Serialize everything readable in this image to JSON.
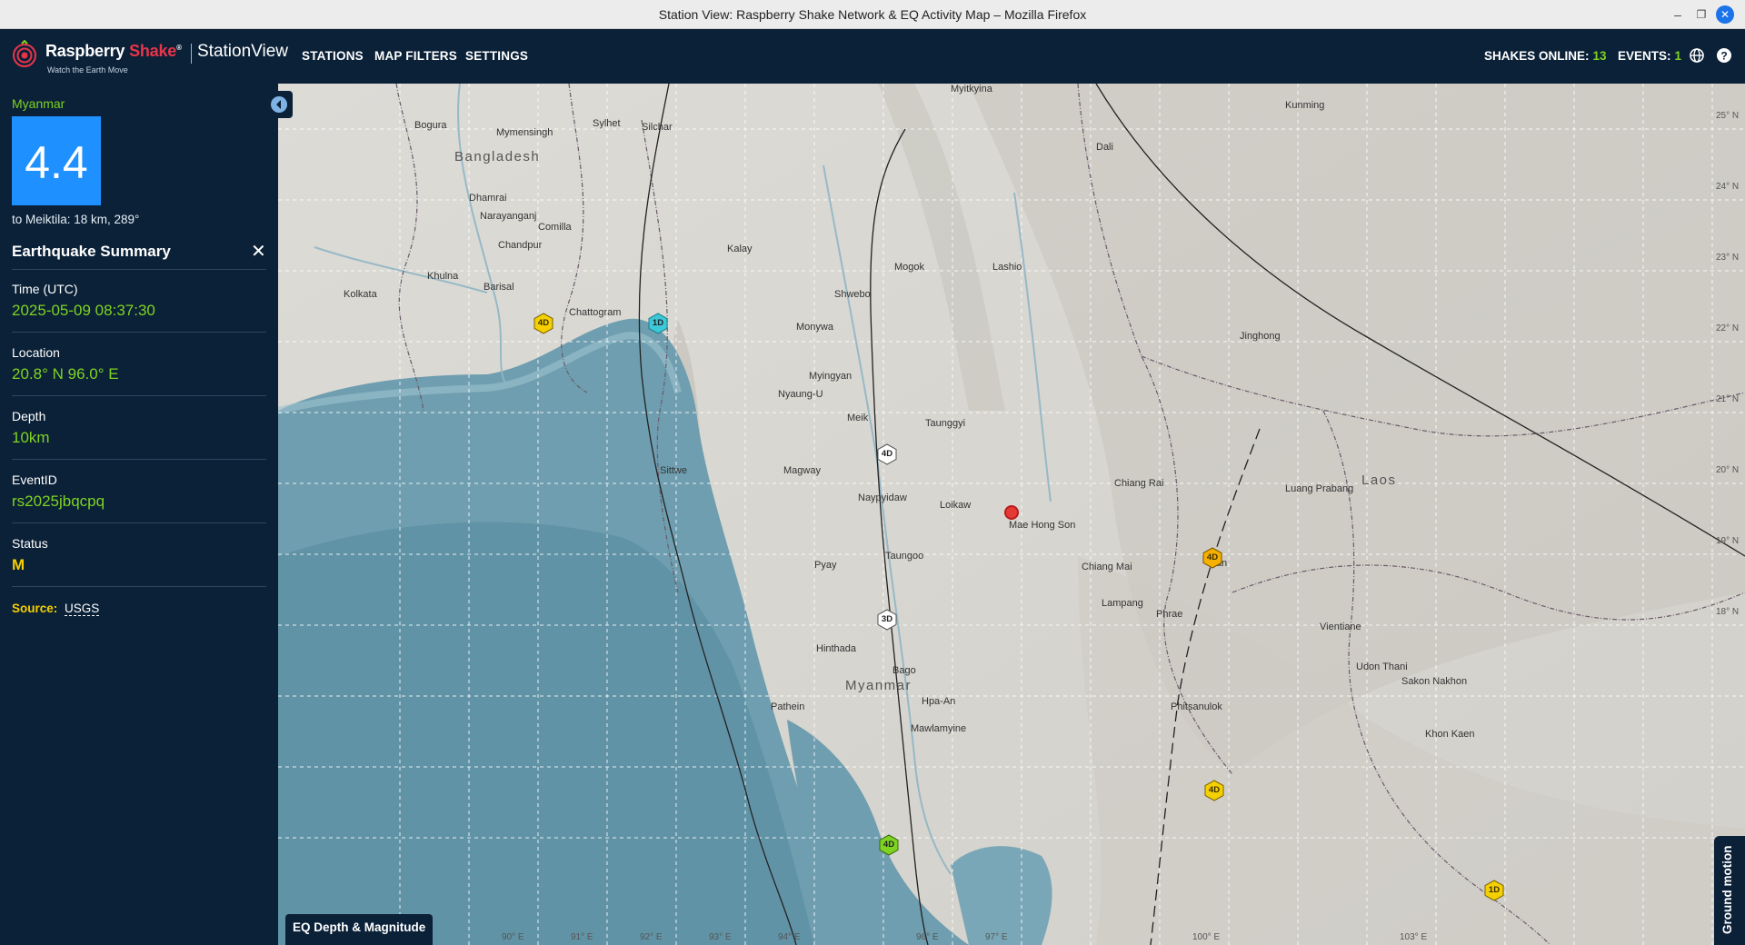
{
  "window": {
    "title": "Station View: Raspberry Shake Network & EQ Activity Map – Mozilla Firefox",
    "min_glyph": "–",
    "max_glyph": "❐",
    "close_glyph": "✕"
  },
  "header": {
    "brand_part1": "Raspberry",
    "brand_part2": "Shake",
    "product": "StationView",
    "tagline": "Watch the Earth Move",
    "nav": {
      "stations": "STATIONS",
      "filters": "MAP FILTERS",
      "settings": "SETTINGS"
    },
    "shakes_label": "SHAKES ONLINE:",
    "shakes_count": "13",
    "events_label": "EVENTS:",
    "events_count": "1",
    "icons": [
      "globe-icon",
      "help-icon"
    ]
  },
  "panel": {
    "region": "Myanmar",
    "magnitude": "4.4",
    "distance": "to Meiktila: 18 km, 289°",
    "summary_title": "Earthquake Summary",
    "close_glyph": "✕",
    "fields": [
      {
        "label": "Time (UTC)",
        "value": "2025-05-09 08:37:30"
      },
      {
        "label": "Location",
        "value": "20.8° N 96.0° E"
      },
      {
        "label": "Depth",
        "value": "10km"
      },
      {
        "label": "EventID",
        "value": "rs2025jbqcpq"
      },
      {
        "label": "Status",
        "value": "M"
      }
    ],
    "source_label": "Source:",
    "source_value": "USGS"
  },
  "map": {
    "legend_button": "EQ Depth & Magnitude",
    "ground_motion_button": "Ground motion",
    "labels": {
      "bangladesh": "Bangladesh",
      "myanmar": "Myanmar",
      "laos": "Laos",
      "dhaka": "Dhamrai",
      "narayanganj": "Narayanganj",
      "sylhet": "Sylhet",
      "mymensingh": "Mymensingh",
      "bogura": "Bogura",
      "comilla": "Comilla",
      "chandpur": "Chandpur",
      "khulna": "Khulna",
      "barisal": "Barisal",
      "kolkata": "Kolkata",
      "chattogram": "Chattogram",
      "silchar": "Silchar",
      "kalay": "Kalay",
      "monywa": "Monywa",
      "shwebo": "Shwebo",
      "myingyan": "Myingyan",
      "nyaungu": "Nyaung-U",
      "magway": "Magway",
      "meiktila": "Meik",
      "taunggyi": "Taunggyi",
      "naypyidaw": "Naypyidaw",
      "taungoo": "Taungoo",
      "pyay": "Pyay",
      "hinthada": "Hinthada",
      "pathein": "Pathein",
      "bago": "Bago",
      "lashio": "Lashio",
      "mogok": "Mogok",
      "myitkyina": "Myitkyina",
      "chiangrai": "Chiang Rai",
      "chiangmai": "Chiang Mai",
      "lampang": "Lampang",
      "phrae": "Phrae",
      "nan": "Nan",
      "luangprabang": "Luang Prabang",
      "vientiane": "Vientiane",
      "udonthani": "Udon Thani",
      "khonkaen": "Khon Kaen",
      "kunming": "Kunming",
      "dali": "Dali",
      "jinghong": "Jinghong",
      "sittwe": "Sittwe",
      "maehongson": "Mae Hong Son",
      "loikaw": "Loikaw",
      "hpaan": "Hpa-An",
      "mawlamyine": "Mawlamyine",
      "phitsanulok": "Phitsanulok",
      "sakonnakhon": "Sakon Nakhon"
    },
    "lat_ticks": [
      "25° N",
      "24° N",
      "23° N",
      "22° N",
      "21° N",
      "20° N",
      "19° N",
      "18° N"
    ],
    "lon_ticks": [
      "90° E",
      "91° E",
      "92° E",
      "93° E",
      "94° E",
      "96° E",
      "97° E",
      "100° E",
      "103° E"
    ],
    "stations": [
      {
        "label": "4D",
        "color": "#f5d000"
      },
      {
        "label": "1D",
        "color": "#3cc8d8"
      },
      {
        "label": "4D",
        "color": "#ffffff"
      },
      {
        "label": "3D",
        "color": "#ffffff"
      },
      {
        "label": "4D",
        "color": "#f5b000"
      },
      {
        "label": "4D",
        "color": "#f5d000"
      },
      {
        "label": "4D",
        "color": "#7ed321"
      },
      {
        "label": "1D",
        "color": "#f5d000"
      }
    ],
    "colors": {
      "sea": "#6c9cad",
      "land": "#d9d8d3",
      "quake": "#e53935"
    }
  }
}
